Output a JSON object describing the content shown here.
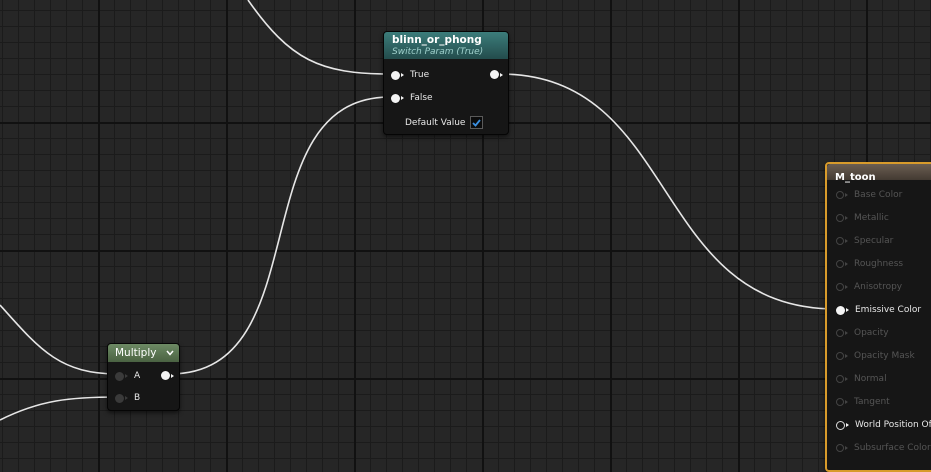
{
  "switch_node": {
    "title": "blinn_or_phong",
    "subtitle": "Switch Param (True)",
    "pin_true": "True",
    "pin_false": "False",
    "default_value_label": "Default Value",
    "default_value_checked": true
  },
  "multiply_node": {
    "title": "Multiply",
    "pin_a": "A",
    "pin_b": "B"
  },
  "material_node": {
    "title": "M_toon",
    "pins": [
      {
        "label": "Base Color",
        "active": false
      },
      {
        "label": "Metallic",
        "active": false
      },
      {
        "label": "Specular",
        "active": false
      },
      {
        "label": "Roughness",
        "active": false
      },
      {
        "label": "Anisotropy",
        "active": false
      },
      {
        "label": "Emissive Color",
        "active": true,
        "connected": true
      },
      {
        "label": "Opacity",
        "active": false
      },
      {
        "label": "Opacity Mask",
        "active": false
      },
      {
        "label": "Normal",
        "active": false
      },
      {
        "label": "Tangent",
        "active": false
      },
      {
        "label": "World Position Offset",
        "active": true,
        "connected": false
      },
      {
        "label": "Subsurface Color",
        "active": false
      }
    ]
  },
  "colors": {
    "canvas_bg": "#262626",
    "wire": "#e6e6e6",
    "switch_header": "#2f6a6a",
    "multiply_header": "#5d7a55",
    "material_border": "#d89b2b",
    "check": "#3a8fe0"
  },
  "icons": {
    "chevron": "chevron-down-icon",
    "check": "checkmark-icon",
    "pin": "exec-pin-icon"
  }
}
